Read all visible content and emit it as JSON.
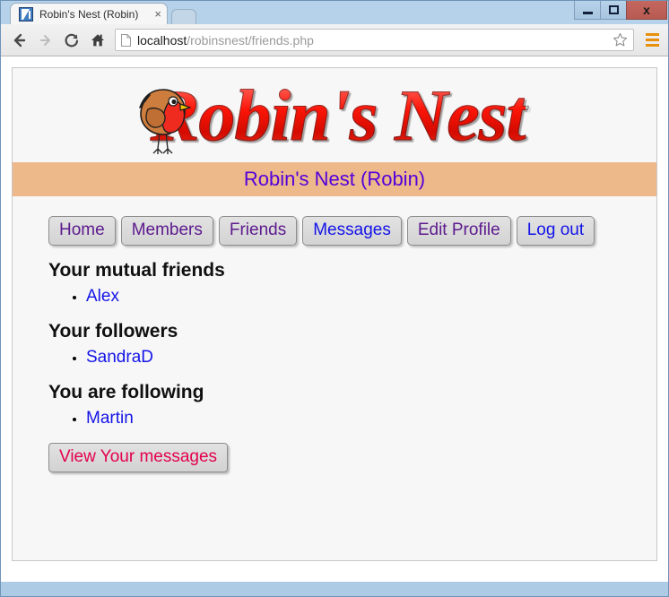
{
  "browser": {
    "window_controls": {
      "minimize": "minimize-button",
      "maximize": "maximize-button",
      "close_label": "x"
    },
    "tab": {
      "title": "Robin's Nest (Robin)",
      "close_label": "×",
      "favicon": "blue-square-slash-icon"
    },
    "toolbar": {
      "back": "back-arrow-icon",
      "forward": "forward-arrow-icon",
      "reload": "reload-icon",
      "home": "home-icon",
      "bookmark": "star-icon",
      "menu": "hamburger-menu-icon",
      "menu_color": "#e8900c"
    },
    "address_bar": {
      "page_icon": "page-document-icon",
      "host": "localhost",
      "path": "/robinsnest/friends.php",
      "full_url": "localhost/robinsnest/friends.php"
    }
  },
  "site": {
    "logo_text": "Robin's Nest",
    "logo_color": "#fb1508",
    "logo_bird": "robin-bird-illustration",
    "banner_color": "#eeb98a",
    "subtitle": "Robin's Nest (Robin)",
    "subtitle_color": "#5300dc"
  },
  "nav": {
    "items": [
      {
        "label": "Home",
        "state": "visited"
      },
      {
        "label": "Members",
        "state": "visited"
      },
      {
        "label": "Friends",
        "state": "visited"
      },
      {
        "label": "Messages",
        "state": "unvisited"
      },
      {
        "label": "Edit Profile",
        "state": "visited"
      },
      {
        "label": "Log out",
        "state": "unvisited"
      }
    ],
    "visited_color": "#5d1a8e",
    "unvisited_color": "#1414e8"
  },
  "main": {
    "sections": [
      {
        "heading": "Your mutual friends",
        "people": [
          "Alex"
        ]
      },
      {
        "heading": "Your followers",
        "people": [
          "SandraD"
        ]
      },
      {
        "heading": "You are following",
        "people": [
          "Martin"
        ]
      }
    ],
    "messages_button": "View Your messages",
    "messages_button_color": "#e4004e",
    "link_color": "#1414e8"
  }
}
